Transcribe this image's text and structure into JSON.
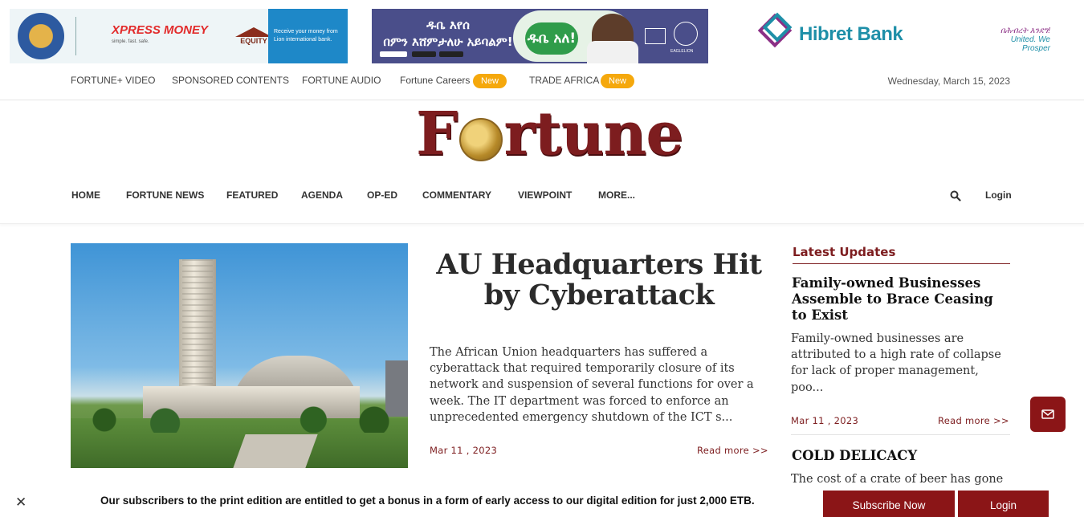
{
  "ads": {
    "lion_tagline": "Receive your money from Lion international bank.",
    "xpress_brand": "XPRESS MONEY",
    "xpress_sub": "simple. fast. safe.",
    "equity_brand": "EQUITY",
    "dube_headline": "ዱቤ እየሰ\nበምን እሸምታለሁ አይባልም!",
    "dube_badge": "ዱቤ አለ!",
    "eaglelion_label": "EAGLELION",
    "hibret_brand": "Hibret Bank",
    "hibret_amharic": "በሕብረት እንደግ!",
    "hibret_slogan": "United. We Prosper"
  },
  "topbar": {
    "links": [
      "FORTUNE+ VIDEO",
      "SPONSORED CONTENTS",
      "FORTUNE AUDIO",
      "Fortune Careers",
      "TRADE AFRICA"
    ],
    "new_badge": "New",
    "date": "Wednesday, March 15, 2023"
  },
  "masthead": {
    "before_coin": "F",
    "after_coin": "rtune"
  },
  "nav": {
    "items": [
      "HOME",
      "FORTUNE NEWS",
      "FEATURED",
      "AGENDA",
      "OP-ED",
      "COMMENTARY",
      "VIEWPOINT",
      "MORE..."
    ],
    "login": "Login"
  },
  "hero": {
    "title": "AU Headquarters Hit by Cyberattack",
    "excerpt": "The African Union headquarters has suffered a cyberattack that required temporarily closure of  its network and suspension of several functions for over a week. The IT department was forced to enforce an unprecedented emergency shutdown of the ICT s...",
    "date": "Mar 11 , 2023",
    "read_more": "Read more >>"
  },
  "sidebar": {
    "heading": "Latest Updates",
    "articles": [
      {
        "title": "Family-owned Businesses Assemble to Brace Ceasing to Exist",
        "excerpt": "Family-owned businesses are attributed to a high rate of collapse for lack of proper management, poo...",
        "date": "Mar 11 , 2023",
        "read_more": "Read more >>"
      },
      {
        "title": "COLD DELICACY",
        "excerpt": "The cost of a crate of beer has gone"
      }
    ]
  },
  "notice": {
    "text": "Our subscribers to the print edition are entitled to get a bonus in a form of early access to our digital edition for just 2,000 ETB.",
    "subscribe": "Subscribe Now",
    "login": "Login",
    "close": "✕"
  },
  "colors": {
    "brand": "#7d1d1f",
    "button": "#8b1517",
    "badge": "#f5a80c"
  }
}
